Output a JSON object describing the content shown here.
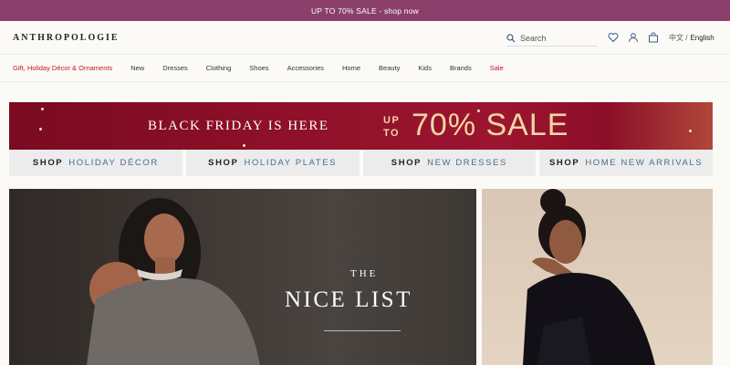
{
  "promo": {
    "text": "UP TO 70% SALE - shop now"
  },
  "header": {
    "logo": "ANTHROPOLOGIE",
    "search_placeholder": "Search",
    "lang_zh": "中文 /",
    "lang_en": "English"
  },
  "nav": {
    "items": [
      "Gift, Holiday Décor & Ornaments",
      "New",
      "Dresses",
      "Clothing",
      "Shoes",
      "Accessories",
      "Home",
      "Beauty",
      "Kids",
      "Brands",
      "Sale"
    ]
  },
  "hero": {
    "headline": "BLACK FRIDAY IS HERE",
    "upto_line1": "UP",
    "upto_line2": "TO",
    "sale": "70% SALE"
  },
  "shop_buttons": [
    {
      "lead": "SHOP",
      "category": "HOLIDAY DÉCOR"
    },
    {
      "lead": "SHOP",
      "category": "HOLIDAY PLATES"
    },
    {
      "lead": "SHOP",
      "category": "NEW DRESSES"
    },
    {
      "lead": "SHOP",
      "category": "HOME NEW ARRIVALS"
    }
  ],
  "feature": {
    "the": "THE",
    "nice_list": "NICE LIST"
  },
  "colors": {
    "promo_bg": "#8a3f6b",
    "hero_bg": "#8e1029",
    "accent_red": "#c8102e",
    "sale_gold": "#f2d6a3"
  }
}
